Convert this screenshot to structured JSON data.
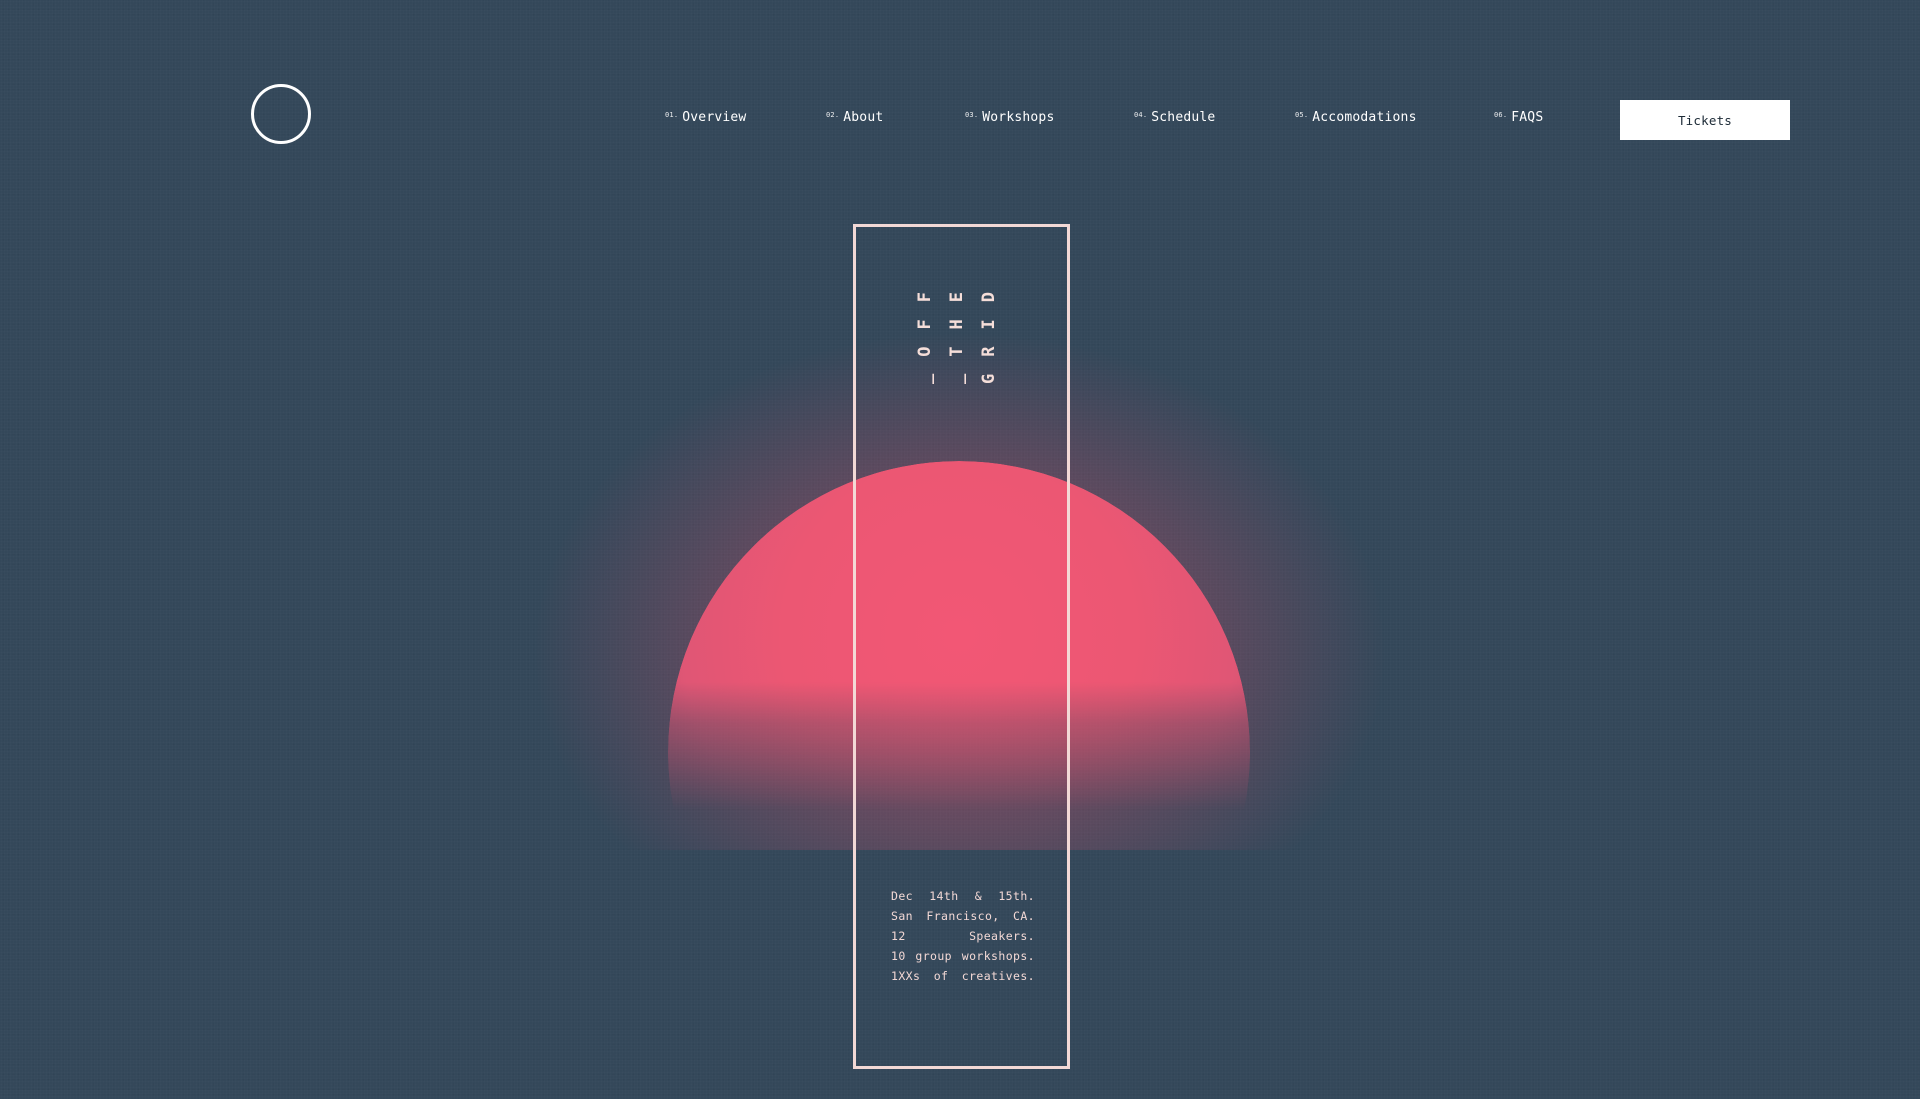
{
  "header": {
    "logo_name": "circle-logo",
    "nav": [
      {
        "num": "01.",
        "label": "Overview"
      },
      {
        "num": "02.",
        "label": "About"
      },
      {
        "num": "03.",
        "label": "Workshops"
      },
      {
        "num": "04.",
        "label": "Schedule"
      },
      {
        "num": "05.",
        "label": "Accomodations"
      },
      {
        "num": "06.",
        "label": "FAQS"
      }
    ],
    "tickets_label": "Tickets"
  },
  "hero": {
    "title_columns": [
      "_OFF",
      "_THE",
      "GRID"
    ],
    "details": [
      [
        "Dec",
        "14th",
        "&",
        "15th."
      ],
      [
        "San",
        "Francisco,",
        "CA."
      ],
      [
        "12",
        "Speakers."
      ],
      [
        "10",
        "group",
        "workshops."
      ],
      [
        "1XXs",
        "of",
        "creatives."
      ]
    ]
  },
  "colors": {
    "background": "#34485a",
    "sun": "#f25775",
    "card_border": "#f3d9d6",
    "button_bg": "#ffffff"
  }
}
